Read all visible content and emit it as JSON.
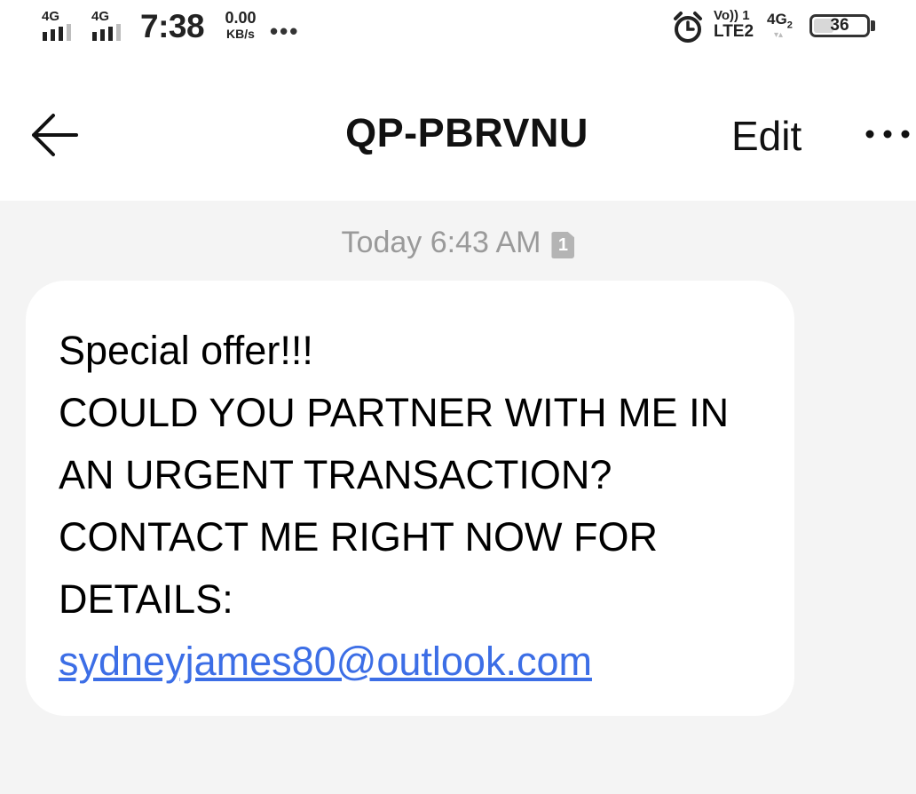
{
  "status_bar": {
    "sim1_network": "4G",
    "sim2_network": "4G",
    "time": "7:38",
    "net_speed_value": "0.00",
    "net_speed_unit": "KB/s",
    "overflow": "•••",
    "volte_label": "Vo)) 1",
    "lte_label": "LTE2",
    "sim2_network_label": "4G",
    "sim2_sub": "2",
    "battery_level": "36",
    "icons": [
      "signal-icon",
      "alarm-icon",
      "battery-icon"
    ]
  },
  "header": {
    "title": "QP-PBRVNU",
    "edit_label": "Edit",
    "back_icon": "arrow-left-icon",
    "more_icon": "more-horizontal-icon"
  },
  "conversation": {
    "timestamp": "Today 6:43 AM",
    "sim_badge": "1",
    "message": {
      "lines": [
        "Special offer!!!",
        "COULD YOU PARTNER WITH ME IN",
        "AN URGENT TRANSACTION?",
        "CONTACT ME RIGHT NOW FOR",
        "DETAILS:"
      ],
      "link": "sydneyjames80@outlook.com"
    }
  },
  "colors": {
    "background": "#f4f4f4",
    "bubble": "#ffffff",
    "link": "#3c6ee6",
    "timestamp": "#9a9a9a"
  }
}
